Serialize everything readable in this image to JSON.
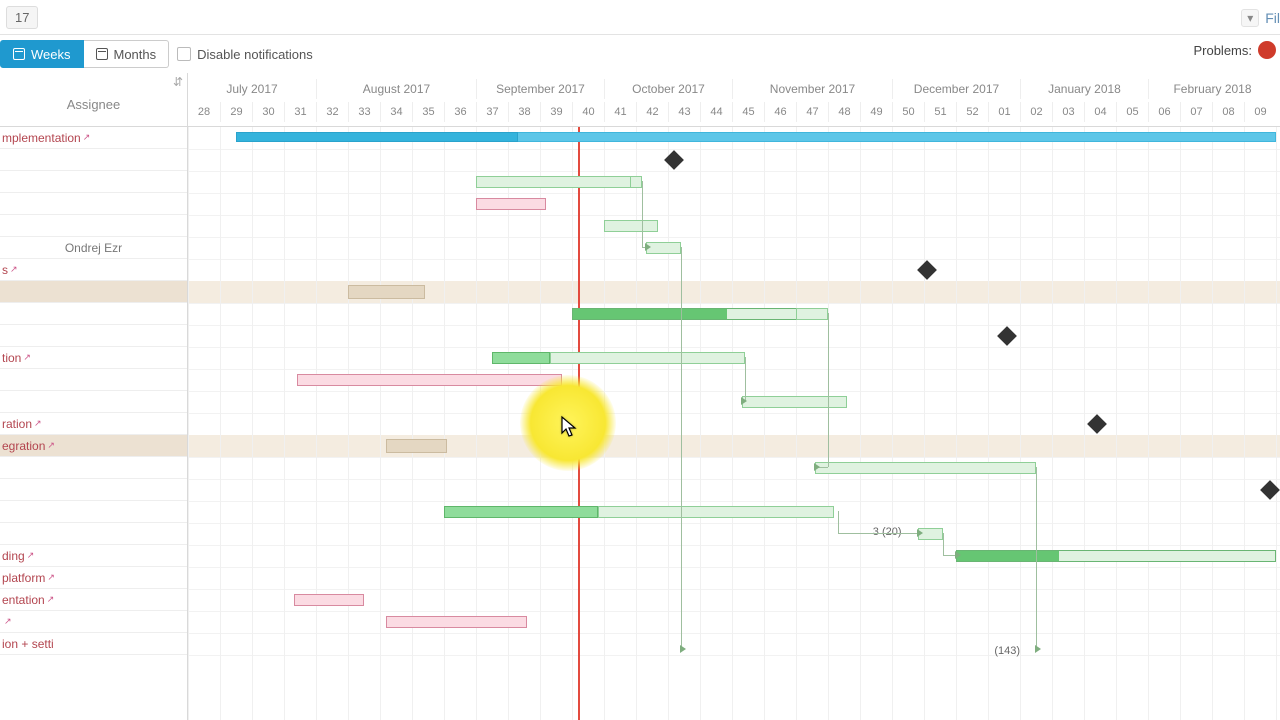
{
  "top": {
    "issue_number": "17",
    "filter_label": "Fil"
  },
  "toolbar": {
    "weeks": "Weeks",
    "months": "Months",
    "disable_notifications": "Disable notifications",
    "problems_label": "Problems:",
    "problems_count": ""
  },
  "columns": {
    "assignee_header": "Assignee"
  },
  "months": [
    {
      "label": "July 2017",
      "weeks": 4
    },
    {
      "label": "August 2017",
      "weeks": 5
    },
    {
      "label": "September 2017",
      "weeks": 4
    },
    {
      "label": "October 2017",
      "weeks": 4
    },
    {
      "label": "November 2017",
      "weeks": 5
    },
    {
      "label": "December 2017",
      "weeks": 4
    },
    {
      "label": "January 2018",
      "weeks": 4
    },
    {
      "label": "February 2018",
      "weeks": 4
    }
  ],
  "weeks": [
    "28",
    "29",
    "30",
    "31",
    "32",
    "33",
    "34",
    "35",
    "36",
    "37",
    "38",
    "39",
    "40",
    "41",
    "42",
    "43",
    "44",
    "45",
    "46",
    "47",
    "48",
    "49",
    "50",
    "51",
    "52",
    "01",
    "02",
    "03",
    "04",
    "05",
    "06",
    "07",
    "08",
    "09"
  ],
  "rows": [
    {
      "label": "mplementation",
      "type": "link",
      "shaded": false
    },
    {
      "label": "",
      "shaded": false
    },
    {
      "label": "",
      "shaded": false
    },
    {
      "label": "",
      "shaded": false
    },
    {
      "label": "",
      "shaded": false
    },
    {
      "label": "",
      "assignee": "Ondrej Ezr",
      "shaded": false
    },
    {
      "label": "s",
      "type": "link",
      "shaded": false
    },
    {
      "label": "",
      "shaded": true
    },
    {
      "label": "",
      "shaded": false
    },
    {
      "label": "",
      "shaded": false
    },
    {
      "label": "tion",
      "type": "link",
      "shaded": false
    },
    {
      "label": "",
      "shaded": false
    },
    {
      "label": "",
      "shaded": false
    },
    {
      "label": "ration",
      "type": "link",
      "shaded": false
    },
    {
      "label": "egration",
      "type": "link",
      "shaded": true
    },
    {
      "label": "",
      "shaded": false
    },
    {
      "label": "",
      "shaded": false
    },
    {
      "label": "",
      "shaded": false
    },
    {
      "label": "",
      "shaded": false
    },
    {
      "label": "ding",
      "type": "link",
      "shaded": false
    },
    {
      "label": "platform",
      "type": "link",
      "shaded": false
    },
    {
      "label": "entation",
      "type": "link",
      "shaded": false
    },
    {
      "label": "",
      "type": "link",
      "shaded": false
    },
    {
      "label": "ion + setti",
      "shaded": false
    }
  ],
  "bar_labels": {
    "label_143": "(143)",
    "label_3_20": "3 (20)"
  },
  "colors": {
    "today_line": "#e34a3e",
    "summary_bar": "#5dc6e8",
    "progress_green": "#66c673",
    "pink": "#f0b4c4",
    "beige": "#e4d7c2",
    "milestone": "#333333",
    "highlight": "#f8e733"
  }
}
